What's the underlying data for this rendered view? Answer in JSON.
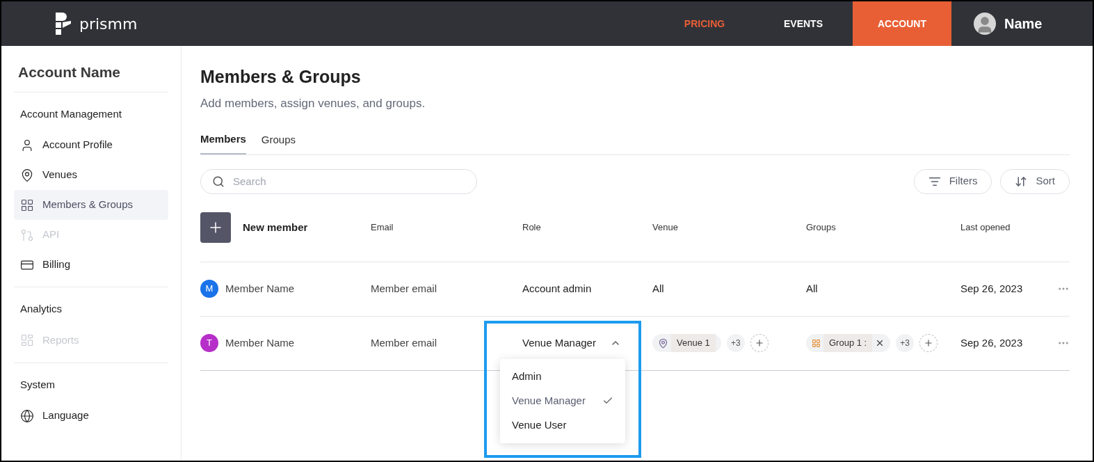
{
  "header": {
    "logo": "prismm",
    "nav": [
      {
        "label": "PRICING",
        "kind": "promo",
        "selected": false
      },
      {
        "label": "EVENTS",
        "kind": "link",
        "selected": false
      },
      {
        "label": "ACCOUNT",
        "kind": "link",
        "selected": true
      }
    ],
    "user": "Name"
  },
  "sidebar": {
    "title": "Account Name",
    "sections": [
      {
        "title": "Account Management",
        "items": [
          {
            "label": "Account Profile",
            "selected": false,
            "disabled": false
          },
          {
            "label": "Venues",
            "selected": false,
            "disabled": false
          },
          {
            "label": "Members & Groups",
            "selected": true,
            "disabled": false
          },
          {
            "label": "API",
            "selected": false,
            "disabled": true
          },
          {
            "label": "Billing",
            "selected": false,
            "disabled": false
          }
        ]
      },
      {
        "title": "Analytics",
        "items": [
          {
            "label": "Reports",
            "selected": false,
            "disabled": true
          }
        ]
      },
      {
        "title": "System",
        "items": [
          {
            "label": "Language",
            "selected": false,
            "disabled": false
          }
        ]
      }
    ]
  },
  "page": {
    "title": "Members & Groups",
    "subtitle": "Add members, assign venues, and groups.",
    "tabs": [
      {
        "label": "Members",
        "selected": true
      },
      {
        "label": "Groups",
        "selected": false
      }
    ],
    "search": {
      "placeholder": "Search"
    },
    "buttons": [
      "Filters",
      "Sort"
    ]
  },
  "table": {
    "new_member": "New member",
    "columns": [
      "Email",
      "Role",
      "Venue",
      "Groups",
      "Last opened"
    ],
    "rows": [
      {
        "initial": "M",
        "color": "#1a73e8",
        "name": "Member Name",
        "email": "Member email",
        "role": "Account admin",
        "role_open": false,
        "venue": {
          "kind": "text",
          "text": "All"
        },
        "groups": {
          "kind": "text",
          "text": "All"
        },
        "last_opened": "Sep 26, 2023"
      },
      {
        "initial": "T",
        "color": "#b62fc9",
        "name": "Member Name",
        "email": "Member email",
        "role": "Venue Manager",
        "role_open": true,
        "venue": {
          "kind": "chips",
          "text": "Venue 1",
          "more": "+3"
        },
        "groups": {
          "kind": "chips",
          "text": "Group 1 :",
          "more": "+3"
        },
        "last_opened": "Sep 26, 2023"
      }
    ]
  },
  "role_menu": {
    "options": [
      {
        "label": "Admin",
        "selected": false
      },
      {
        "label": "Venue Manager",
        "selected": true
      },
      {
        "label": "Venue User",
        "selected": false
      }
    ]
  }
}
